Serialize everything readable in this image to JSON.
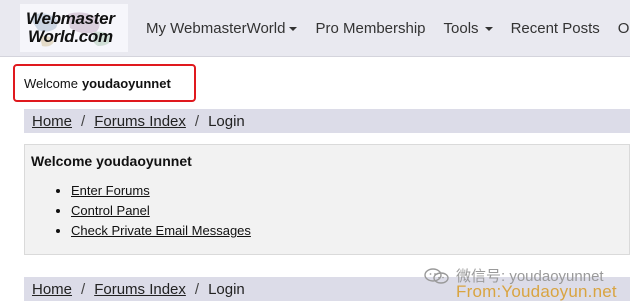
{
  "logo": {
    "line1": "Webmaster",
    "line2": "World.com"
  },
  "nav": {
    "items": [
      {
        "label": "My WebmasterWorld",
        "has_dropdown": true
      },
      {
        "label": "Pro Membership",
        "has_dropdown": false
      },
      {
        "label": "Tools",
        "has_dropdown": true
      },
      {
        "label": "Recent Posts",
        "has_dropdown": false
      },
      {
        "label": "Open",
        "has_dropdown": false
      }
    ]
  },
  "welcome": {
    "prefix": "Welcome",
    "username": "youdaoyunnet",
    "highlight_color": "#e0191e"
  },
  "breadcrumb": {
    "home": "Home",
    "forums_index": "Forums Index",
    "current": "Login",
    "separator": "/"
  },
  "panel": {
    "title": "Welcome youdaoyunnet",
    "links": [
      "Enter Forums",
      "Control Panel",
      "Check Private Email Messages"
    ]
  },
  "watermark": {
    "line1": "微信号: youdaoyunnet",
    "line2": "From:Youdaoyun.net"
  }
}
